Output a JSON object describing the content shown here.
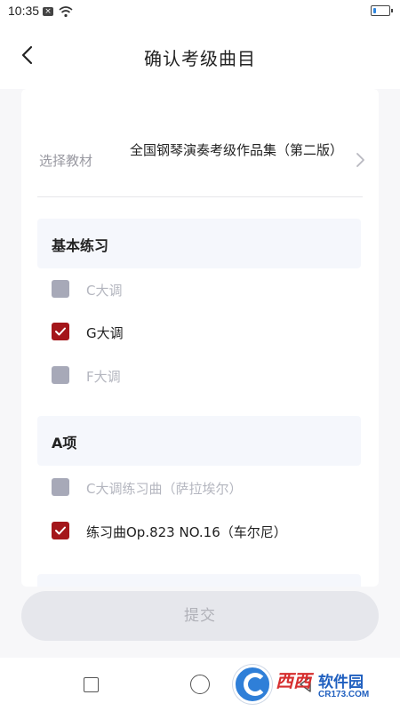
{
  "status_bar": {
    "time": "10:35",
    "sim_icon": "sim-x-icon",
    "wifi_icon": "wifi-icon",
    "battery_icon": "battery-icon",
    "battery_level": 0.2,
    "battery_color": "#2e86de"
  },
  "header": {
    "title": "确认考级曲目",
    "back_icon": "chevron-left-icon"
  },
  "textbook": {
    "label": "选择教材",
    "value": "全国钢琴演奏考级作品集（第二版）",
    "chevron_icon": "chevron-right-icon"
  },
  "sections": [
    {
      "title": "基本练习",
      "items": [
        {
          "label": "C大调",
          "checked": false
        },
        {
          "label": "G大调",
          "checked": true
        },
        {
          "label": "F大调",
          "checked": false
        }
      ]
    },
    {
      "title": "A项",
      "items": [
        {
          "label": "C大调练习曲（萨拉埃尔）",
          "checked": false
        },
        {
          "label": "练习曲Op.823  NO.16（车尔尼）",
          "checked": true
        }
      ]
    }
  ],
  "submit": {
    "label": "提交"
  },
  "colors": {
    "checked": "#a4161a",
    "unchecked": "#a7a9b8",
    "section_bg": "#f5f7fc",
    "button_bg": "#e6e7ec"
  },
  "navbar": {
    "icons": [
      "recent-apps-icon",
      "home-icon",
      "back-icon"
    ]
  },
  "watermark": {
    "title": "西西",
    "subtitle": "软件园",
    "url": "CR173.COM"
  }
}
